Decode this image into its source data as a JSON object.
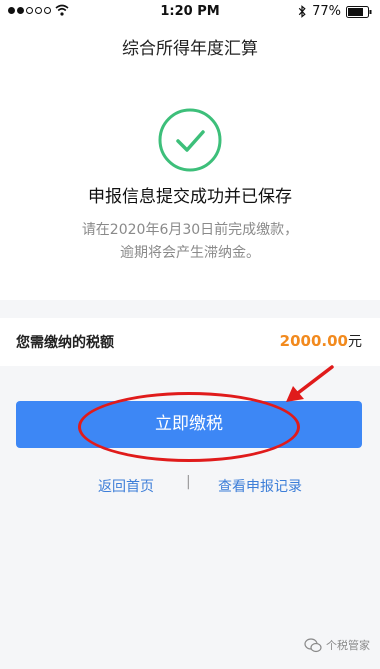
{
  "status_bar": {
    "time": "1:20 PM",
    "battery": "77%",
    "icons": [
      "signal-dots-icon",
      "wifi-icon",
      "bluetooth-icon",
      "battery-icon"
    ]
  },
  "header": {
    "title": "综合所得年度汇算"
  },
  "result": {
    "icon": "success-check-icon",
    "message": "申报信息提交成功并已保存",
    "notice_line1": "请在2020年6月30日前完成缴款，",
    "notice_line2": "逾期将会产生滞纳金。"
  },
  "tax": {
    "label": "您需缴纳的税额",
    "amount": "2000.00",
    "unit": "元"
  },
  "actions": {
    "pay_label": "立即缴税",
    "home_label": "返回首页",
    "divider": "|",
    "records_label": "查看申报记录"
  },
  "watermark": {
    "icon": "wechat-icon",
    "text": "个税管家"
  },
  "colors": {
    "accent_blue": "#3d87f5",
    "success_green": "#3dbf7a",
    "amount_orange": "#f28a1e",
    "annotation_red": "#e01b1b",
    "page_bg": "#f5f6f8"
  }
}
